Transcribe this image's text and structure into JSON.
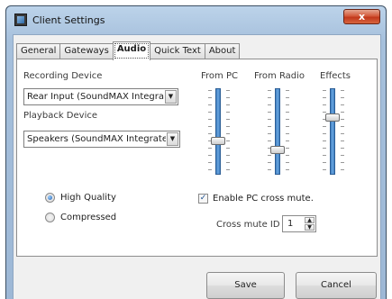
{
  "window": {
    "title": "Client Settings",
    "close_label": "x"
  },
  "tabs": [
    {
      "label": "General"
    },
    {
      "label": "Gateways"
    },
    {
      "label": "Audio",
      "active": true
    },
    {
      "label": "Quick Text"
    },
    {
      "label": "About"
    }
  ],
  "audio": {
    "recording_device_label": "Recording Device",
    "recording_device_value": "Rear Input (SoundMAX Integrate",
    "playback_device_label": "Playback Device",
    "playback_device_value": "Speakers (SoundMAX Integrated",
    "sliders": [
      {
        "label": "From PC",
        "level": 0.62
      },
      {
        "label": "From Radio",
        "level": 0.74
      },
      {
        "label": "Effects",
        "level": 0.32
      }
    ],
    "quality_options": [
      {
        "label": "High Quality",
        "selected": true
      },
      {
        "label": "Compressed",
        "selected": false
      }
    ],
    "cross_mute_label": "Enable PC cross mute.",
    "cross_mute_checked": true,
    "cross_mute_id_label": "Cross mute ID",
    "cross_mute_id_value": "1"
  },
  "footer": {
    "save_label": "Save",
    "cancel_label": "Cancel"
  }
}
